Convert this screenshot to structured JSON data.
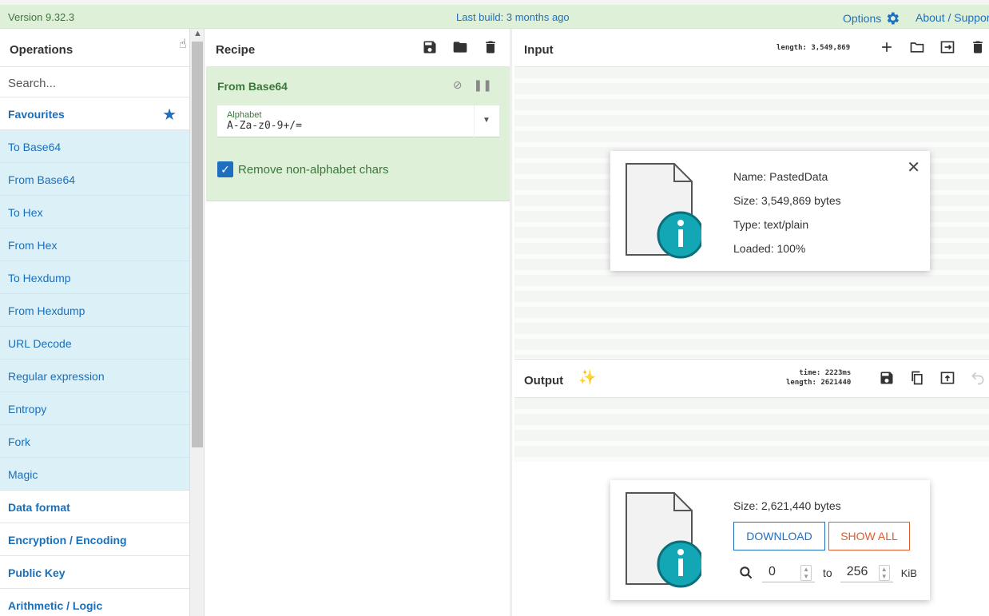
{
  "topbar": {
    "version": "Version 9.32.3",
    "last_build": "Last build: 3 months ago",
    "options": "Options",
    "about": "About / Support"
  },
  "operations": {
    "title": "Operations",
    "search_placeholder": "Search...",
    "favourites": "Favourites",
    "items": [
      "To Base64",
      "From Base64",
      "To Hex",
      "From Hex",
      "To Hexdump",
      "From Hexdump",
      "URL Decode",
      "Regular expression",
      "Entropy",
      "Fork",
      "Magic"
    ],
    "categories": [
      "Data format",
      "Encryption / Encoding",
      "Public Key",
      "Arithmetic / Logic"
    ]
  },
  "recipe": {
    "title": "Recipe",
    "operation": {
      "name": "From Base64",
      "alphabet_label": "Alphabet",
      "alphabet_value": "A-Za-z0-9+/=",
      "checkbox_label": "Remove non-alphabet chars",
      "checkbox_checked": true
    }
  },
  "input": {
    "title": "Input",
    "length": "length: 3,549,869",
    "file": {
      "name": "Name: PastedData",
      "size": "Size: 3,549,869 bytes",
      "type": "Type: text/plain",
      "loaded": "Loaded: 100%"
    }
  },
  "output": {
    "title": "Output",
    "time": "time:  2223ms",
    "length": "length: 2621440",
    "file": {
      "size": "Size: 2,621,440 bytes",
      "download": "DOWNLOAD",
      "show_all": "SHOW ALL",
      "from": "0",
      "to_label": "to",
      "to": "256",
      "unit": "KiB"
    }
  },
  "colors": {
    "accent": "#1f6fbf",
    "success_bg": "#dff0d8",
    "success_text": "#3c763d",
    "favourite_bg": "#dcf0f7",
    "show_all": "#e25a2b"
  }
}
